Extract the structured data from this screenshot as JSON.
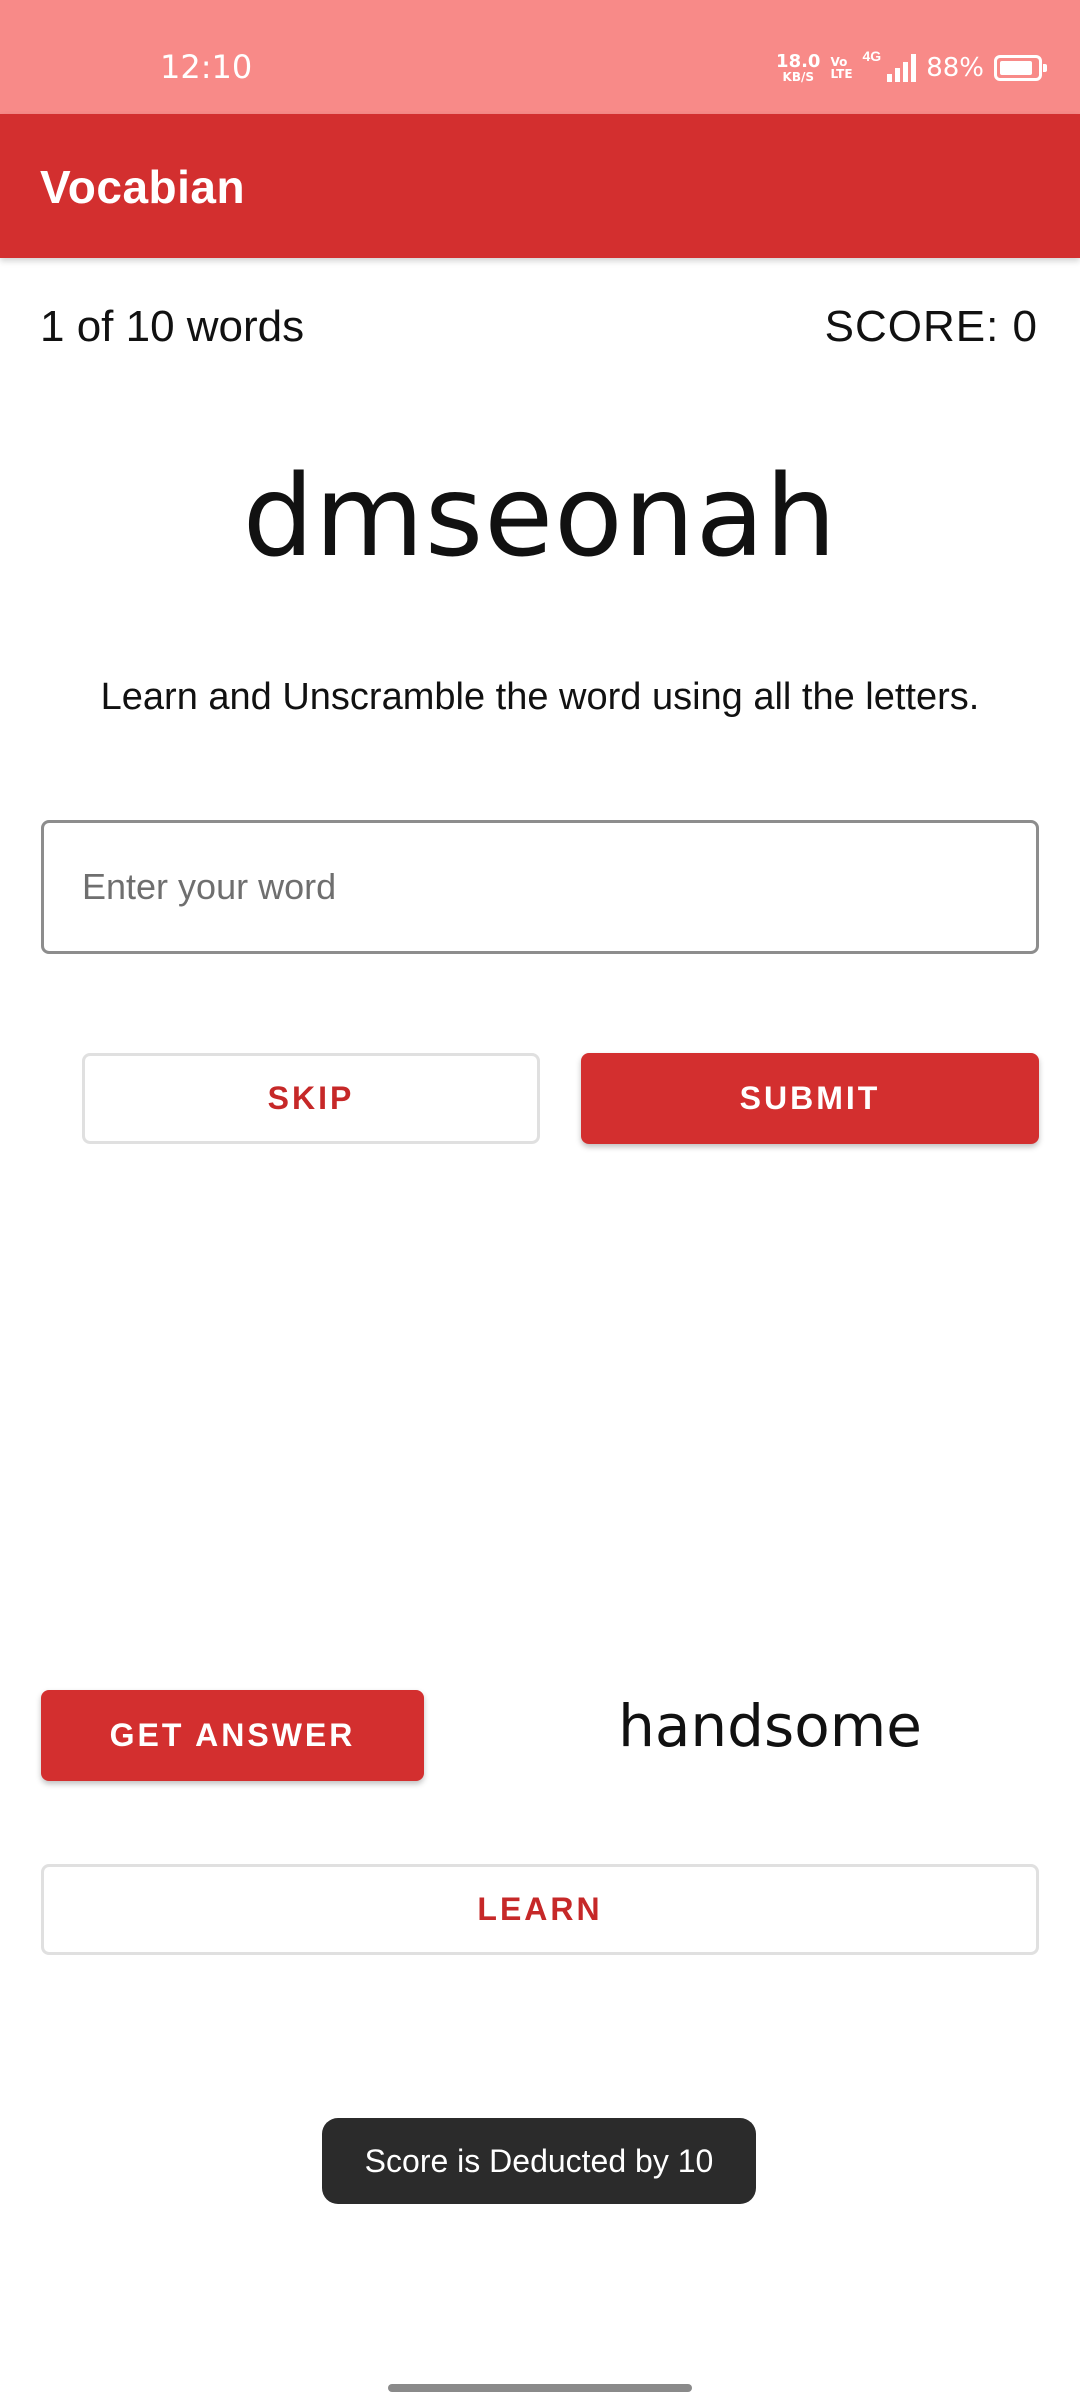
{
  "status_bar": {
    "time": "12:10",
    "net_speed_value": "18.0",
    "net_speed_unit": "KB/S",
    "volte_top": "Vo",
    "volte_bottom": "LTE",
    "network_type": "4G",
    "battery_percent": "88%",
    "battery_level": 0.88
  },
  "app_bar": {
    "title": "Vocabian",
    "color": "#d32f2f"
  },
  "game": {
    "word_count": "1 of 10 words",
    "score": "SCORE: 0",
    "scrambled_word": "dmseonah",
    "instructions": "Learn and Unscramble the word using all the letters.",
    "input_placeholder": "Enter your word",
    "input_value": ""
  },
  "buttons": {
    "skip": "SKIP",
    "submit": "SUBMIT",
    "get_answer": "GET ANSWER",
    "learn": "LEARN"
  },
  "answer": {
    "text": "handsome"
  },
  "toast": {
    "message": "Score is Deducted by 10"
  },
  "colors": {
    "status_bar": "#f88a88",
    "accent": "#d32f2f",
    "toast_bg": "#2b2b2b"
  }
}
